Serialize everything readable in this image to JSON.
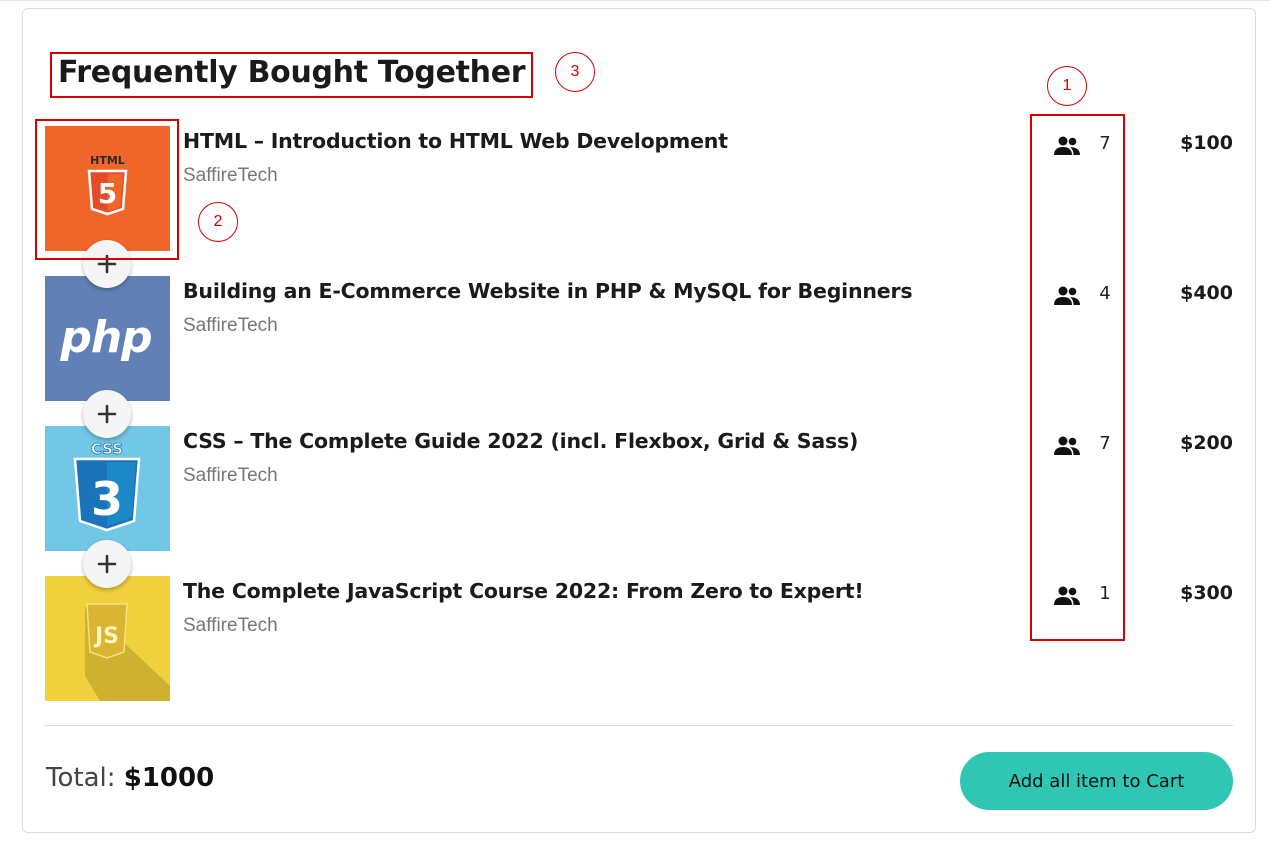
{
  "section": {
    "title": "Frequently Bought Together"
  },
  "courses": [
    {
      "title": "HTML – Introduction to HTML Web Development",
      "author": "SaffireTech",
      "students": "7",
      "price": "$100",
      "thumb_icon": "html5-logo",
      "thumb_label": "HTML",
      "thumb_glyph": "5"
    },
    {
      "title": "Building an E-Commerce Website in PHP & MySQL for Beginners",
      "author": "SaffireTech",
      "students": "4",
      "price": "$400",
      "thumb_icon": "php-logo",
      "thumb_label": "php"
    },
    {
      "title": "CSS – The Complete Guide 2022 (incl. Flexbox, Grid & Sass)",
      "author": "SaffireTech",
      "students": "7",
      "price": "$200",
      "thumb_icon": "css3-logo",
      "thumb_label": "CSS",
      "thumb_glyph": "3"
    },
    {
      "title": "The Complete JavaScript Course 2022: From Zero to Expert!",
      "author": "SaffireTech",
      "students": "1",
      "price": "$300",
      "thumb_icon": "js-logo",
      "thumb_glyph": "JS"
    }
  ],
  "footer": {
    "total_label": "Total:",
    "total_value": "$1000",
    "add_button_label": "Add all item to Cart"
  },
  "annotations": [
    "1",
    "2",
    "3"
  ],
  "colors": {
    "accent_button": "#2fc6b3",
    "annotation_red": "#d40000",
    "html_orange": "#f06529",
    "php_blue": "#6181b6",
    "css_blue": "#72c6e6",
    "js_yellow": "#f0d03d"
  }
}
